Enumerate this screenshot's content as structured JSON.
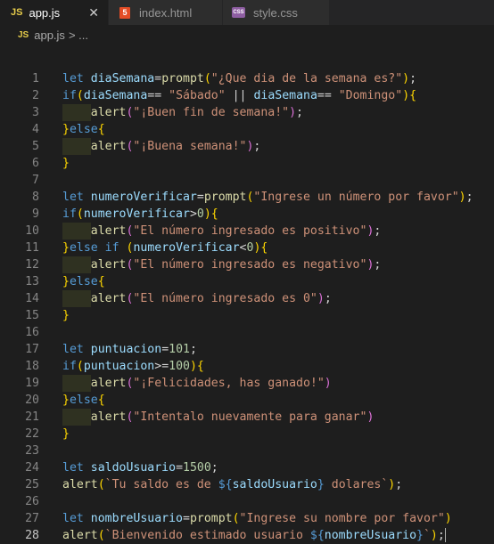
{
  "tabs": [
    {
      "badge": "JS",
      "label": "app.js",
      "close": "✕"
    },
    {
      "badge": "5",
      "label": "index.html"
    },
    {
      "badge": "CSS",
      "label": "style.css"
    }
  ],
  "breadcrumb": {
    "badge": "JS",
    "file": "app.js",
    "separator": "> ..."
  },
  "colors": {
    "keyword": "#569cd6",
    "variable": "#9cdcfe",
    "function": "#dcdcaa",
    "string": "#ce9178",
    "number": "#b5cea8",
    "bracket1": "#ffd700",
    "bracket2": "#da70d6",
    "bracket3": "#179fff",
    "operator": "#d4d4d4"
  },
  "code": {
    "current_line": 28,
    "lines": [
      {
        "n": "1",
        "t": [
          [
            "let",
            "kw"
          ],
          [
            " ",
            ""
          ],
          [
            "diaSemana",
            "var"
          ],
          [
            "=",
            ""
          ],
          [
            "prompt",
            "fn"
          ],
          [
            "(",
            "b1"
          ],
          [
            "\"¿Que dia de la semana es?\"",
            "str"
          ],
          [
            ")",
            "b1"
          ],
          [
            ";",
            ""
          ]
        ]
      },
      {
        "n": "2",
        "t": [
          [
            "if",
            "kw"
          ],
          [
            "(",
            "b1"
          ],
          [
            "diaSemana",
            "var"
          ],
          [
            "== ",
            ""
          ],
          [
            "\"Sábado\"",
            "str"
          ],
          [
            " || ",
            ""
          ],
          [
            "diaSemana",
            "var"
          ],
          [
            "== ",
            ""
          ],
          [
            "\"Domingo\"",
            "str"
          ],
          [
            ")",
            "b1"
          ],
          [
            "{",
            "b1"
          ]
        ]
      },
      {
        "n": "3",
        "indent": 1,
        "t": [
          [
            "alert",
            "fn"
          ],
          [
            "(",
            "b2"
          ],
          [
            "\"¡Buen fin de semana!\"",
            "str"
          ],
          [
            ")",
            "b2"
          ],
          [
            ";",
            ""
          ]
        ]
      },
      {
        "n": "4",
        "t": [
          [
            "}",
            "b1"
          ],
          [
            "else",
            "kw"
          ],
          [
            "{",
            "b1"
          ]
        ]
      },
      {
        "n": "5",
        "indent": 1,
        "t": [
          [
            "alert",
            "fn"
          ],
          [
            "(",
            "b2"
          ],
          [
            "\"¡Buena semana!\"",
            "str"
          ],
          [
            ")",
            "b2"
          ],
          [
            ";",
            ""
          ]
        ]
      },
      {
        "n": "6",
        "t": [
          [
            "}",
            "b1"
          ]
        ]
      },
      {
        "n": "7",
        "t": []
      },
      {
        "n": "8",
        "t": [
          [
            "let",
            "kw"
          ],
          [
            " ",
            ""
          ],
          [
            "numeroVerificar",
            "var"
          ],
          [
            "=",
            ""
          ],
          [
            "prompt",
            "fn"
          ],
          [
            "(",
            "b1"
          ],
          [
            "\"Ingrese un número por favor\"",
            "str"
          ],
          [
            ")",
            "b1"
          ],
          [
            ";",
            ""
          ]
        ]
      },
      {
        "n": "9",
        "t": [
          [
            "if",
            "kw"
          ],
          [
            "(",
            "b1"
          ],
          [
            "numeroVerificar",
            "var"
          ],
          [
            ">",
            ""
          ],
          [
            "0",
            "num"
          ],
          [
            ")",
            "b1"
          ],
          [
            "{",
            "b1"
          ]
        ]
      },
      {
        "n": "10",
        "indent": 1,
        "t": [
          [
            "alert",
            "fn"
          ],
          [
            "(",
            "b2"
          ],
          [
            "\"El número ingresado es positivo\"",
            "str"
          ],
          [
            ")",
            "b2"
          ],
          [
            ";",
            ""
          ]
        ]
      },
      {
        "n": "11",
        "t": [
          [
            "}",
            "b1"
          ],
          [
            "else if ",
            "kw"
          ],
          [
            "(",
            "b1"
          ],
          [
            "numeroVerificar",
            "var"
          ],
          [
            "<",
            ""
          ],
          [
            "0",
            "num"
          ],
          [
            ")",
            "b1"
          ],
          [
            "{",
            "b1"
          ]
        ]
      },
      {
        "n": "12",
        "indent": 1,
        "t": [
          [
            "alert",
            "fn"
          ],
          [
            "(",
            "b2"
          ],
          [
            "\"El número ingresado es negativo\"",
            "str"
          ],
          [
            ")",
            "b2"
          ],
          [
            ";",
            ""
          ]
        ]
      },
      {
        "n": "13",
        "t": [
          [
            "}",
            "b1"
          ],
          [
            "else",
            "kw"
          ],
          [
            "{",
            "b1"
          ]
        ]
      },
      {
        "n": "14",
        "indent": 1,
        "t": [
          [
            "alert",
            "fn"
          ],
          [
            "(",
            "b2"
          ],
          [
            "\"El número ingresado es 0\"",
            "str"
          ],
          [
            ")",
            "b2"
          ],
          [
            ";",
            ""
          ]
        ]
      },
      {
        "n": "15",
        "t": [
          [
            "}",
            "b1"
          ]
        ]
      },
      {
        "n": "16",
        "t": []
      },
      {
        "n": "17",
        "t": [
          [
            "let",
            "kw"
          ],
          [
            " ",
            ""
          ],
          [
            "puntuacion",
            "var"
          ],
          [
            "=",
            ""
          ],
          [
            "101",
            "num"
          ],
          [
            ";",
            ""
          ]
        ]
      },
      {
        "n": "18",
        "t": [
          [
            "if",
            "kw"
          ],
          [
            "(",
            "b1"
          ],
          [
            "puntuacion",
            "var"
          ],
          [
            ">=",
            ""
          ],
          [
            "100",
            "num"
          ],
          [
            ")",
            "b1"
          ],
          [
            "{",
            "b1"
          ]
        ]
      },
      {
        "n": "19",
        "indent": 1,
        "t": [
          [
            "alert",
            "fn"
          ],
          [
            "(",
            "b2"
          ],
          [
            "\"¡Felicidades, has ganado!\"",
            "str"
          ],
          [
            ")",
            "b2"
          ]
        ]
      },
      {
        "n": "20",
        "t": [
          [
            "}",
            "b1"
          ],
          [
            "else",
            "kw"
          ],
          [
            "{",
            "b1"
          ]
        ]
      },
      {
        "n": "21",
        "indent": 1,
        "t": [
          [
            "alert",
            "fn"
          ],
          [
            "(",
            "b2"
          ],
          [
            "\"Intentalo nuevamente para ganar\"",
            "str"
          ],
          [
            ")",
            "b2"
          ]
        ]
      },
      {
        "n": "22",
        "t": [
          [
            "}",
            "b1"
          ]
        ]
      },
      {
        "n": "23",
        "t": []
      },
      {
        "n": "24",
        "t": [
          [
            "let",
            "kw"
          ],
          [
            " ",
            ""
          ],
          [
            "saldoUsuario",
            "var"
          ],
          [
            "=",
            ""
          ],
          [
            "1500",
            "num"
          ],
          [
            ";",
            ""
          ]
        ]
      },
      {
        "n": "25",
        "t": [
          [
            "alert",
            "fn"
          ],
          [
            "(",
            "b1"
          ],
          [
            "`Tu saldo es de ",
            "str"
          ],
          [
            "${",
            "kw"
          ],
          [
            "saldoUsuario",
            "var"
          ],
          [
            "}",
            "kw"
          ],
          [
            " dolares`",
            "str"
          ],
          [
            ")",
            "b1"
          ],
          [
            ";",
            ""
          ]
        ]
      },
      {
        "n": "26",
        "t": []
      },
      {
        "n": "27",
        "t": [
          [
            "let",
            "kw"
          ],
          [
            " ",
            ""
          ],
          [
            "nombreUsuario",
            "var"
          ],
          [
            "=",
            ""
          ],
          [
            "prompt",
            "fn"
          ],
          [
            "(",
            "b1"
          ],
          [
            "\"Ingrese su nombre por favor\"",
            "str"
          ],
          [
            ")",
            "b1"
          ]
        ]
      },
      {
        "n": "28",
        "t": [
          [
            "alert",
            "fn"
          ],
          [
            "(",
            "b1"
          ],
          [
            "`Bienvenido estimado usuario ",
            "str"
          ],
          [
            "${",
            "kw"
          ],
          [
            "nombreUsuario",
            "var"
          ],
          [
            "}",
            "kw"
          ],
          [
            "`",
            "str"
          ],
          [
            ")",
            "b1"
          ],
          [
            ";",
            ""
          ]
        ],
        "cursor": true
      }
    ]
  }
}
